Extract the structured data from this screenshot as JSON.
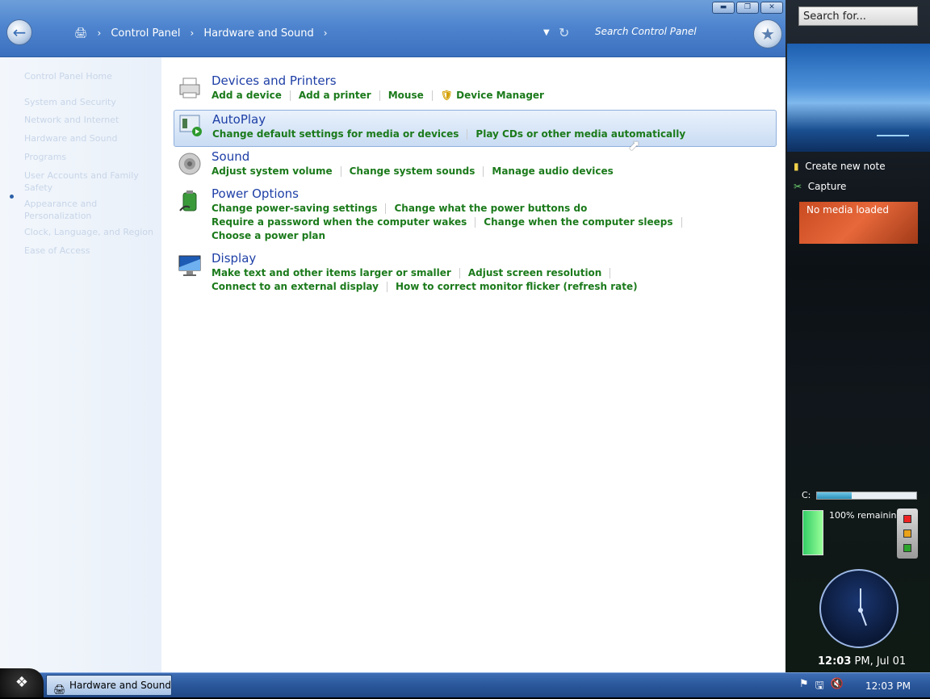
{
  "breadcrumb": {
    "root": "Control Panel",
    "current": "Hardware and Sound"
  },
  "search": {
    "placeholder": "Search Control Panel"
  },
  "sidebar": {
    "items": [
      "Control Panel Home",
      "System and Security",
      "Network and Internet",
      "Hardware and Sound",
      "Programs",
      "User Accounts and Family Safety",
      "Appearance and Personalization",
      "Clock, Language, and Region",
      "Ease of Access"
    ]
  },
  "categories": [
    {
      "title": "Devices and Printers",
      "links": [
        [
          "Add a device",
          "Add a printer",
          "Mouse",
          "Device Manager"
        ]
      ]
    },
    {
      "title": "AutoPlay",
      "links": [
        [
          "Change default settings for media or devices",
          "Play CDs or other media automatically"
        ]
      ]
    },
    {
      "title": "Sound",
      "links": [
        [
          "Adjust system volume",
          "Change system sounds",
          "Manage audio devices"
        ]
      ]
    },
    {
      "title": "Power Options",
      "links": [
        [
          "Change power-saving settings",
          "Change what the power buttons do"
        ],
        [
          "Require a password when the computer wakes",
          "Change when the computer sleeps"
        ],
        [
          "Choose a power plan"
        ]
      ]
    },
    {
      "title": "Display",
      "links": [
        [
          "Make text and other items larger or smaller",
          "Adjust screen resolution"
        ],
        [
          "Connect to an external display",
          "How to correct monitor flicker (refresh rate)"
        ]
      ]
    }
  ],
  "gadgets": {
    "search": "Search for...",
    "note": "Create new note",
    "capture": "Capture",
    "media": "No media loaded",
    "drive": "C:",
    "drive_fill": 0.35,
    "battery": "100% remaining",
    "clock_time": "12:03",
    "clock_rest": " PM, Jul 01"
  },
  "taskbar": {
    "button": "Hardware and Sound",
    "time": "12:03 PM"
  },
  "colors": {
    "link": "#1b7a1b",
    "title": "#1e3fa6",
    "titlebar": "#4f85cf"
  }
}
